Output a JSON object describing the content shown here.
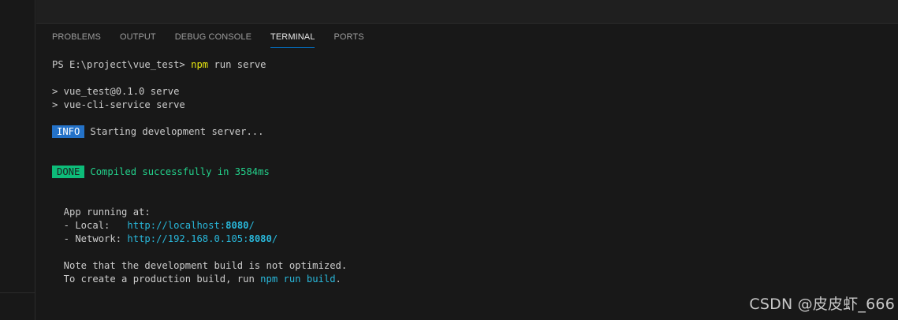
{
  "panel": {
    "tabs": [
      {
        "label": "PROBLEMS"
      },
      {
        "label": "OUTPUT"
      },
      {
        "label": "DEBUG CONSOLE"
      },
      {
        "label": "TERMINAL"
      },
      {
        "label": "PORTS"
      }
    ],
    "active_tab": "TERMINAL"
  },
  "terminal": {
    "prompt": "PS E:\\project\\vue_test> ",
    "command": "npm",
    "command_args": " run serve",
    "script_line_1": "> vue_test@0.1.0 serve",
    "script_line_2": "> vue-cli-service serve",
    "info_badge": "INFO",
    "info_text": "Starting development server...",
    "done_badge": "DONE",
    "done_text": "Compiled successfully in 3584ms",
    "app_running": "  App running at:",
    "local_label": "  - Local:   ",
    "local_url_prefix": "http://localhost:",
    "local_port": "8080",
    "local_url_suffix": "/",
    "network_label": "  - Network: ",
    "network_url_prefix": "http://192.168.0.105:",
    "network_port": "8080",
    "network_url_suffix": "/",
    "note_line": "  Note that the development build is not optimized.",
    "build_prefix": "  To create a production build, run ",
    "build_cmd": "npm run build",
    "build_suffix": "."
  },
  "watermark": "CSDN @皮皮虾_666",
  "colors": {
    "background": "#181818",
    "active_tab_underline": "#0078d4",
    "info_badge": "#2472c8",
    "done_badge": "#0dbc79",
    "success_text": "#23d18b",
    "link": "#29b8db",
    "command": "#e5e510"
  }
}
